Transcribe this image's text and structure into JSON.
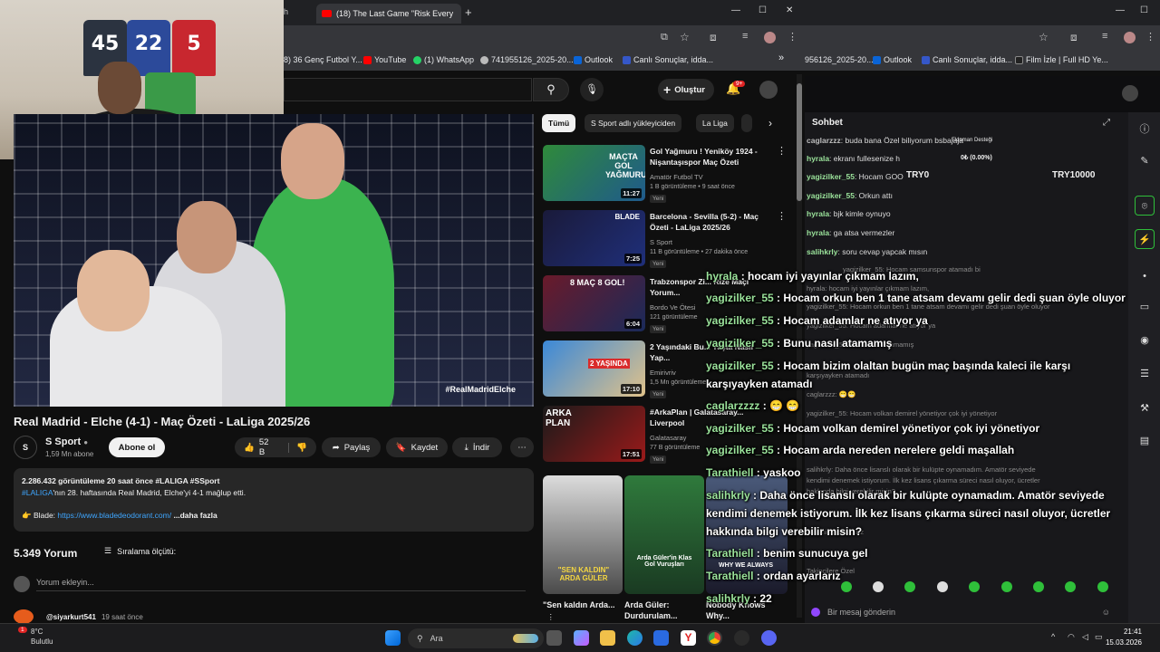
{
  "webcam": {
    "jersey_numbers": [
      "45",
      "22",
      "5"
    ]
  },
  "left_browser": {
    "tab_title": "(18) The Last Game \"Risk Every",
    "tab_prefix": "h",
    "new_tab": "+",
    "window_controls": [
      "—",
      "☐",
      "✕"
    ],
    "bookmarks": [
      {
        "label": "8) 36 Genç Futbol Y...",
        "color": "#888"
      },
      {
        "label": "YouTube",
        "color": "#ff0000"
      },
      {
        "label": "(1) WhatsApp",
        "color": "#25d366"
      },
      {
        "label": "741955126_2025-20...",
        "color": "#bbb"
      },
      {
        "label": "Outlook",
        "color": "#0a64d6"
      },
      {
        "label": "Canlı Sonuçlar, idda...",
        "color": "#3557c8"
      }
    ],
    "bookmarks_more": "»"
  },
  "youtube": {
    "create_label": "Oluştur",
    "notif_count": "9+",
    "player_tag": "#RealMadridElche",
    "video_title": "Real Madrid - Elche (4-1) - Maç Özeti - LaLiga 2025/26",
    "channel": {
      "avatar": "S",
      "name": "S Sport",
      "subs": "1,59 Mn abone",
      "subscribe": "Abone ol"
    },
    "actions": {
      "likes": "52 B",
      "share": "Paylaş",
      "save": "Kaydet",
      "download": "İndir"
    },
    "description": {
      "stats": "2.286.432 görüntüleme  20 saat önce  #LALIGA #SSport",
      "hashtag": "#LALIGA",
      "line1": "'nın 28. haftasında Real Madrid, Elche'yi 4-1 mağlup etti.",
      "sponsor_label": "👉 Blade: ",
      "sponsor_link": "https://www.bladedeodorant.com/",
      "more": "...daha fazla"
    },
    "comments": {
      "count": "5.349 Yorum",
      "sort": "Sıralama ölçütü:",
      "add_placeholder": "Yorum ekleyin...",
      "first_user": "@siyarkurt541",
      "first_time": "19 saat önce"
    },
    "chips": [
      "Tümü",
      "S Sport adlı yükleyiciden",
      "La Liga"
    ],
    "recommendations": [
      {
        "title": "Gol Yağmuru ! Yeniköy 1924 - Nişantaşıspor Maç Özeti",
        "channel": "Amatör Futbol TV",
        "views": "1 B görüntüleme • 9 saat önce",
        "badge": "Yeni",
        "duration": "11:27"
      },
      {
        "title": "Barcelona - Sevilla (5-2) - Maç Özeti - LaLiga 2025/26",
        "channel": "S Sport",
        "views": "11 B görüntüleme • 27 dakika önce",
        "badge": "Yeni",
        "duration": "7:25"
      },
      {
        "title": "Trabzonspor Zi... Rize Maçı Yorum...",
        "channel": "Bordo Ve Ötesi",
        "views": "121 görüntüleme",
        "badge": "Yeni",
        "duration": "6:04"
      },
      {
        "title": "2 Yaşındaki Bu... Yaşta Nasıl Yap...",
        "channel": "Emirivriv",
        "views": "1,5 Mn görüntüleme",
        "badge": "Yeni",
        "duration": "17:10"
      },
      {
        "title": "#ArkaPlan | Galatasaray... Liverpool",
        "channel": "Galatasaray",
        "views": "77 B görüntüleme",
        "badge": "Yeni",
        "duration": "17:51"
      }
    ],
    "thumb_texts": [
      "MAÇTA GOL YAĞMURU",
      "BLADE",
      "8 MAÇ 8 GOL!",
      "2 YAŞINDA",
      "ARKA PLAN"
    ],
    "shorts": [
      {
        "title": "\"Sen kaldın Arda...",
        "overlay": "\"SEN KALDIN\" ARDA GÜLER"
      },
      {
        "title": "Arda Güler: Durdurulam...",
        "overlay": "Arda Güler'in Klas Gol Vuruşları"
      },
      {
        "title": "Nobody Knows Why...",
        "overlay": "WHY WE ALWAYS"
      }
    ]
  },
  "right_browser": {
    "bookmarks": [
      {
        "label": "956126_2025-20...",
        "color": "#bbb"
      },
      {
        "label": "Outlook",
        "color": "#0a64d6"
      },
      {
        "label": "Canlı Sonuçlar, idda...",
        "color": "#3557c8"
      },
      {
        "label": "Film İzle | Full HD Ye...",
        "color": "#222"
      }
    ],
    "window_controls": [
      "—",
      "☐",
      "✕"
    ]
  },
  "chat": {
    "title": "Sohbet",
    "donation_label": "Ekipman Desteği",
    "donation_value": "0₺ (0.00%)",
    "try_label": "TRY0",
    "try_goal": "TRY10000",
    "lines": [
      {
        "user": "caglarzzz",
        "color": "#bdbdbd",
        "text": "buda bana Özel biliyorum bsbajaja"
      },
      {
        "user": "hyrala",
        "color": "#9be39b",
        "text": "ekranı fullesenize h"
      },
      {
        "user": "yagizilker_55",
        "color": "#9be39b",
        "text": "Hocam GOO"
      },
      {
        "user": "yagizilker_55",
        "color": "#9be39b",
        "text": "Orkun attı"
      },
      {
        "user": "hyrala",
        "color": "#9be39b",
        "text": "bjk kimle oynuyo"
      },
      {
        "user": "hyrala",
        "color": "#9be39b",
        "text": "ga atsa vermezler"
      },
      {
        "user": "salihkrly",
        "color": "#9be39b",
        "text": "soru cevap yapcak mısın"
      }
    ],
    "faded_lines": [
      "hyrala: hocam iyi yayınlar çıkmam lazım,",
      "yagizilker_55: Hocam samsunspor atamadı bi",
      "yagizilker_55: Hocam orkun ben 1 tane atsam devamı gelir dedi şuan öyle oluyor",
      "yagizilker_55: Hocam adamlar ne atıyor ya",
      "yagizilker_55: Bunu nasıl atamamış",
      "karşıyayken atamadı",
      "caglarzzz: 😁😁",
      "yagizilker_55: Hocam volkan demirel yönetiyor çok iyi yönetiyor",
      "salihkrly: Daha önce lisanslı olarak bir kulüpte oynamadım. Amatör seviyede",
      "kendimi denemek istiyorum. İlk kez lisans çıkarma süreci nasıl oluyor, ücretler",
      "hakkında bilgi verebilir misin?",
      "Tarathiell: ayarlarız",
      "Takipçilere Özel"
    ],
    "input_placeholder": "Bir mesaj gönderin"
  },
  "overlay_chat": [
    {
      "user": "hyrala",
      "text": "hocam iyi yayınlar çıkmam lazım,"
    },
    {
      "user": "yagizilker_55",
      "text": "Hocam orkun ben 1 tane atsam devamı gelir dedi şuan öyle oluyor"
    },
    {
      "user": "yagizilker_55",
      "text": "Hocam adamlar ne atıyor ya"
    },
    {
      "user": "yagizilker_55",
      "text": "Bunu nasıl atamamış"
    },
    {
      "user": "yagizilker_55",
      "text": "Hocam bizim olaltan bugün maç başında kaleci ile karşı"
    },
    {
      "user": "",
      "text": "karşıyayken atamadı"
    },
    {
      "user": "caglarzzzz",
      "text": "😁 😁"
    },
    {
      "user": "yagizilker_55",
      "text": "Hocam volkan demirel yönetiyor çok iyi yönetiyor"
    },
    {
      "user": "yagizilker_55",
      "text": "Hocam arda nereden nerelere geldi maşallah"
    },
    {
      "user": "Tarathiell",
      "text": "yaskoo"
    },
    {
      "user": "salihkrly",
      "text": "Daha önce lisanslı olarak bir kulüpte oynamadım. Amatör seviyede"
    },
    {
      "user": "",
      "text": "kendimi denemek istiyorum. İlk kez lisans çıkarma süreci nasıl oluyor, ücretler"
    },
    {
      "user": "",
      "text": "hakkında bilgi verebilir misin?"
    },
    {
      "user": "Tarathiell",
      "text": "benim sunucuya gel"
    },
    {
      "user": "Tarathiell",
      "text": "ordan ayarlarız"
    },
    {
      "user": "salihkrly",
      "text": "22"
    }
  ],
  "taskbar": {
    "weather_temp": "8°C",
    "weather_desc": "Bulutlu",
    "search_placeholder": "Ara",
    "time": "21:41",
    "date": "15.03.2026"
  }
}
